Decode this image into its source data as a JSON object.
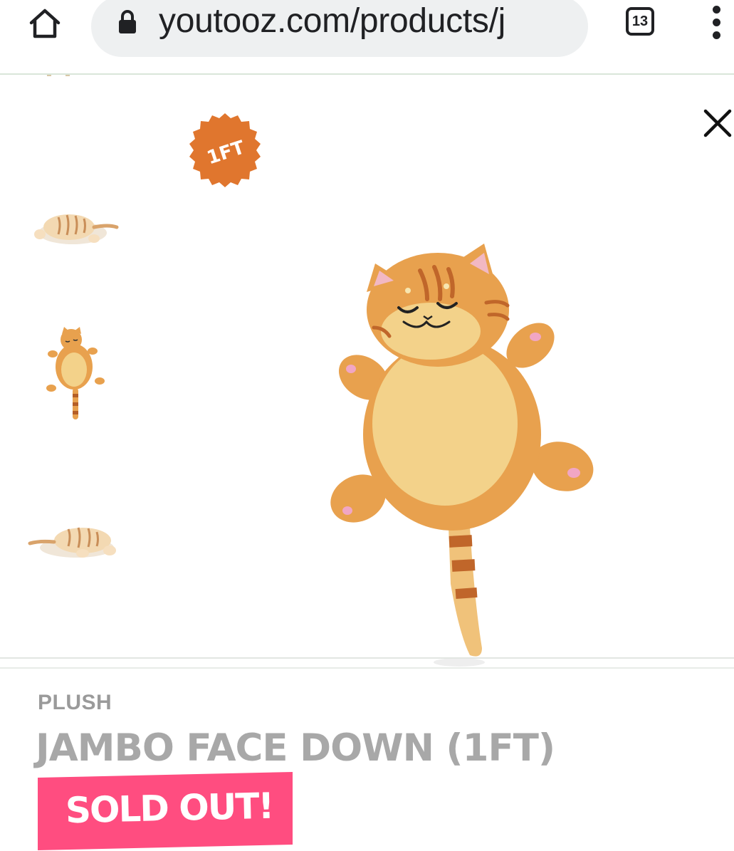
{
  "browser": {
    "url": "youtooz.com/products/j",
    "tab_count": "13"
  },
  "gallery": {
    "badge_text": "1FT",
    "thumbnails": [
      {
        "id": "cat-lying-side"
      },
      {
        "id": "cat-lying-back"
      },
      {
        "id": "cat-lying-side-rear"
      }
    ]
  },
  "product": {
    "category": "PLUSH",
    "title": "JAMBO FACE DOWN (1FT)",
    "status": "SOLD OUT!"
  },
  "colors": {
    "accent_pink": "#ff4d80",
    "badge_orange": "#e0762e",
    "cat_orange": "#e8a14e",
    "cat_belly": "#f3d28a",
    "stripe": "#c0662a"
  }
}
